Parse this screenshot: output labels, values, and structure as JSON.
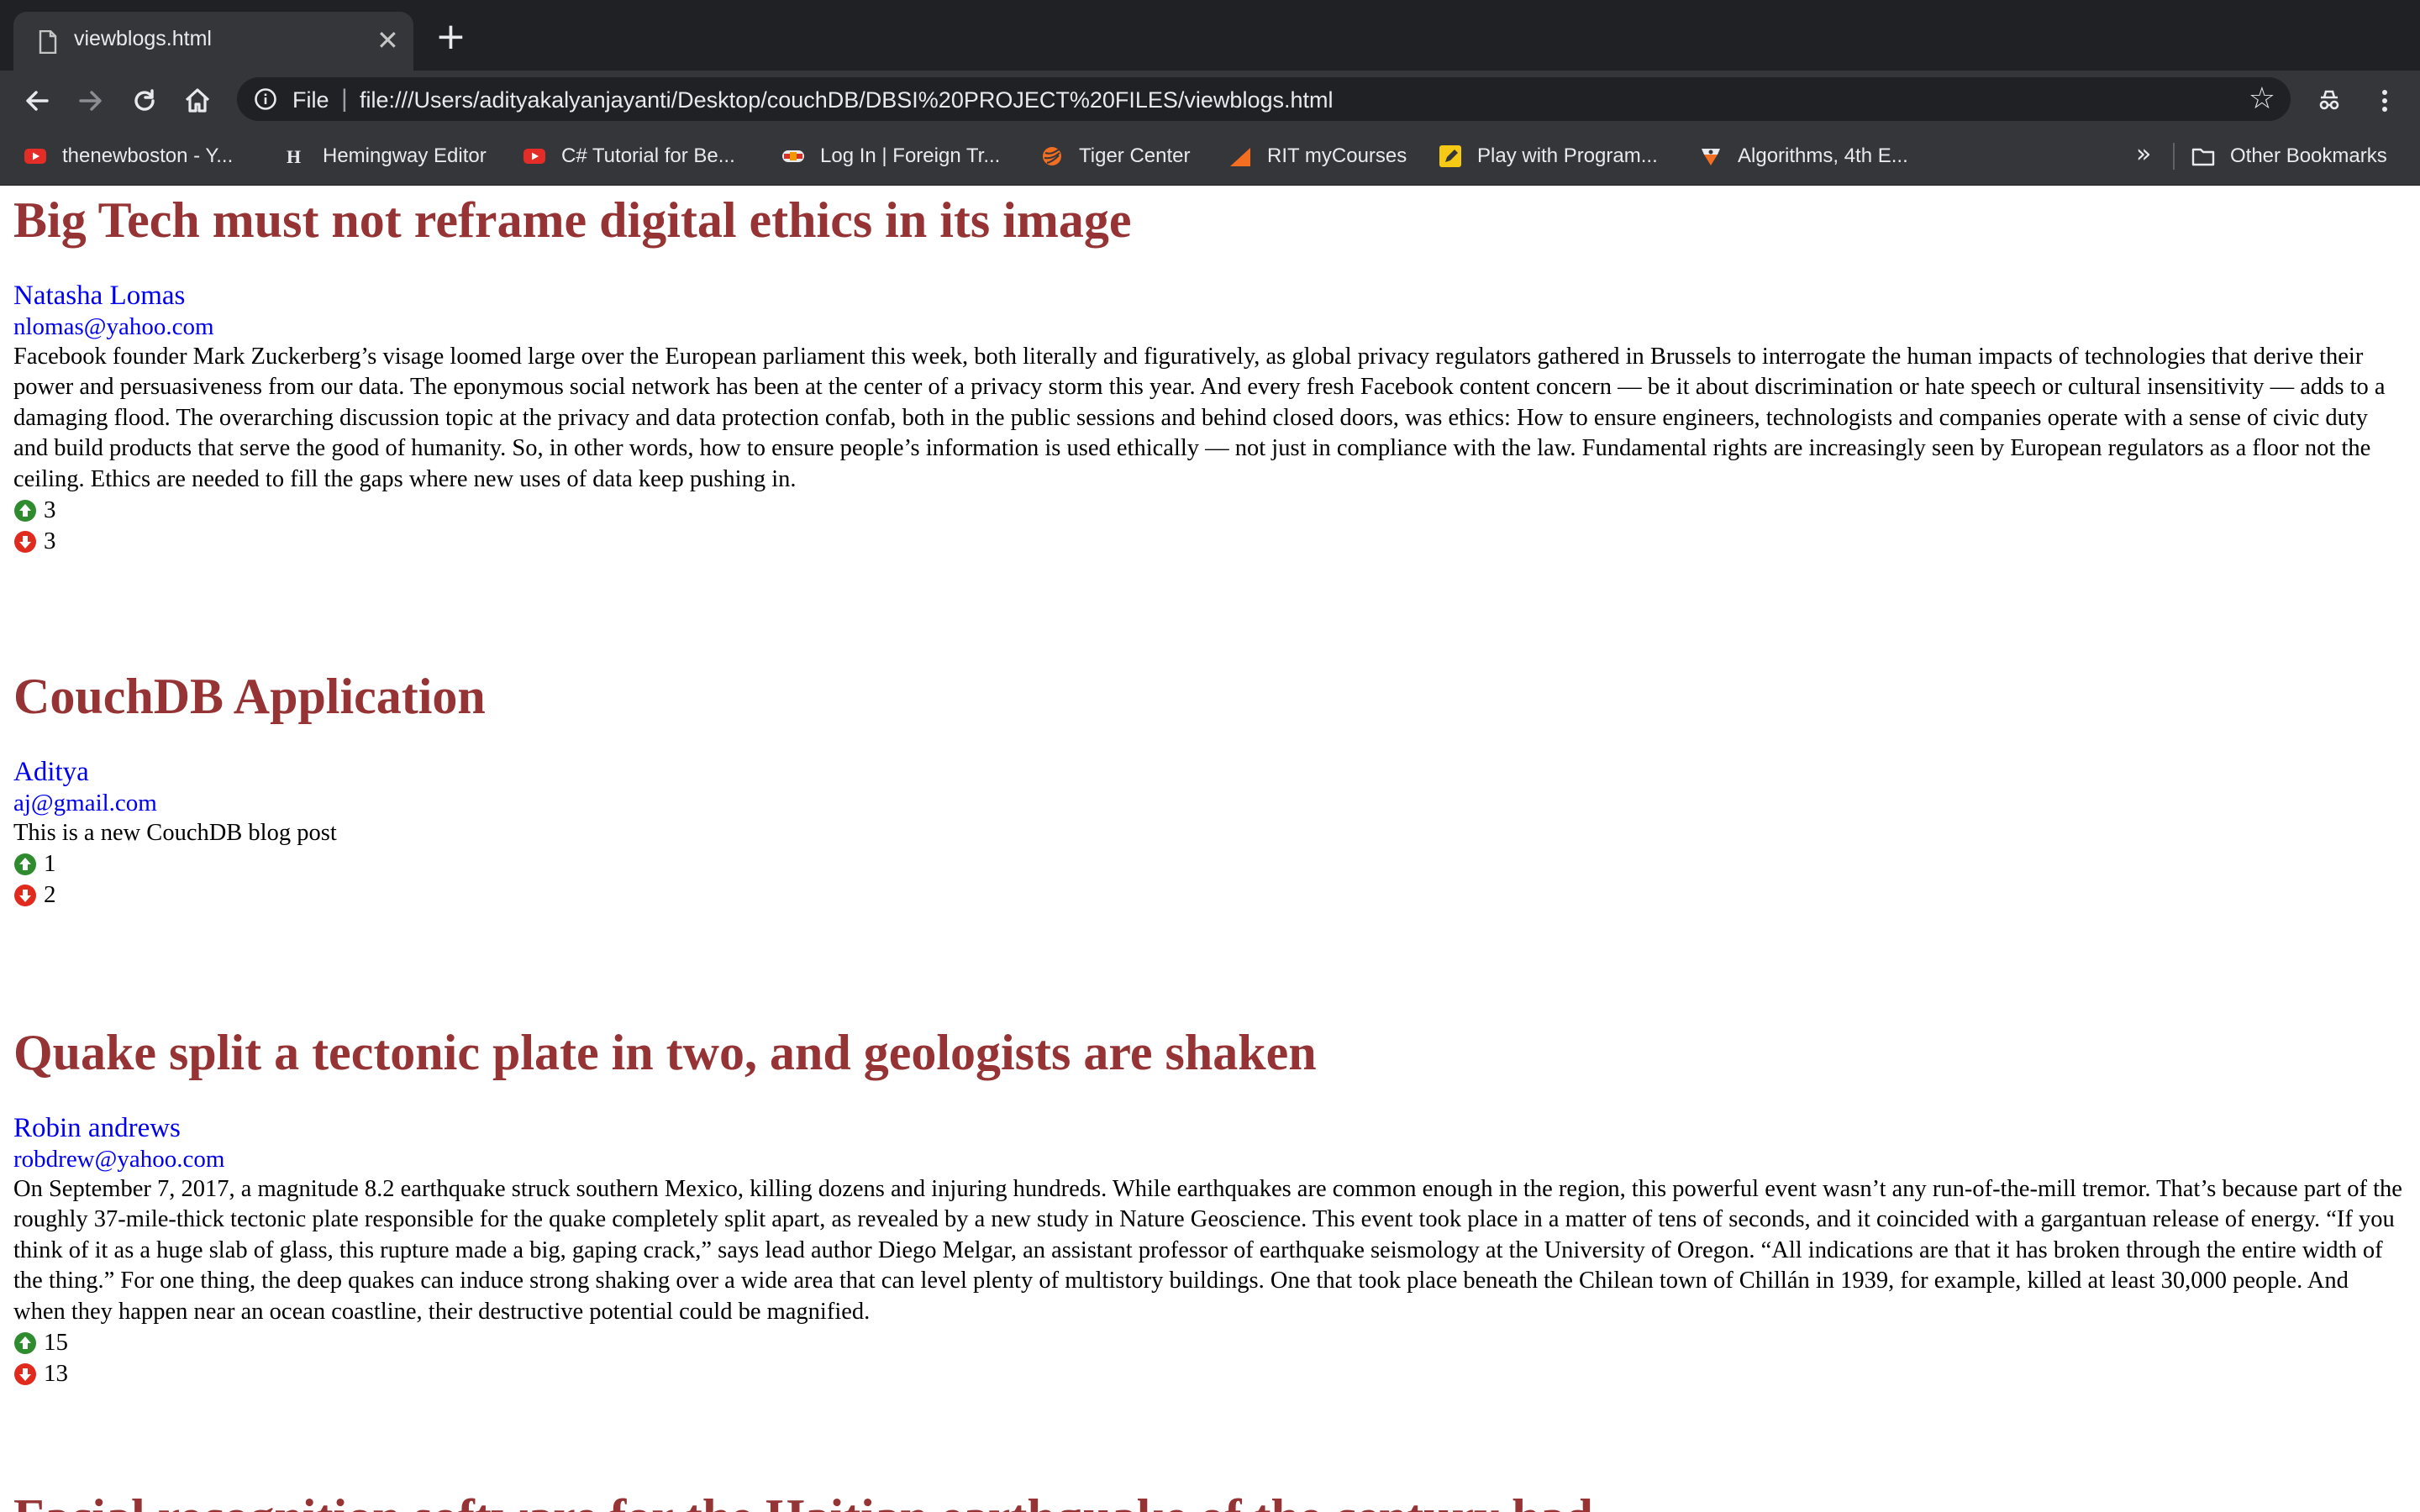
{
  "browser": {
    "tab_title": "viewblogs.html",
    "omnibox_scheme": "File",
    "url": "file:///Users/adityakalyanjayanti/Desktop/couchDB/DBSI%20PROJECT%20FILES/viewblogs.html",
    "bookmarks": [
      {
        "label": "thenewboston - Y...",
        "icon": "youtube-icon"
      },
      {
        "label": "Hemingway Editor",
        "icon": "hemingway-icon"
      },
      {
        "label": "C# Tutorial for Be...",
        "icon": "youtube-icon"
      },
      {
        "label": "Log In | Foreign Tr...",
        "icon": "login-icon"
      },
      {
        "label": "Tiger Center",
        "icon": "tiger-icon"
      },
      {
        "label": "RIT myCourses",
        "icon": "mycourses-icon"
      },
      {
        "label": "Play with Program...",
        "icon": "pencil-icon"
      },
      {
        "label": "Algorithms, 4th E...",
        "icon": "algorithms-icon"
      }
    ],
    "more_label": "»",
    "other_bookmarks": "Other Bookmarks"
  },
  "posts": [
    {
      "title": "Big Tech must not reframe digital ethics in its image",
      "author": "Natasha Lomas",
      "email": "nlomas@yahoo.com",
      "body": "Facebook founder Mark Zuckerberg’s visage loomed large over the European parliament this week, both literally and figuratively, as global privacy regulators gathered in Brussels to interrogate the human impacts of technologies that derive their power and persuasiveness from our data. The eponymous social network has been at the center of a privacy storm this year. And every fresh Facebook content concern — be it about discrimination or hate speech or cultural insensitivity — adds to a damaging flood. The overarching discussion topic at the privacy and data protection confab, both in the public sessions and behind closed doors, was ethics: How to ensure engineers, technologists and companies operate with a sense of civic duty and build products that serve the good of humanity. So, in other words, how to ensure people’s information is used ethically — not just in compliance with the law. Fundamental rights are increasingly seen by European regulators as a floor not the ceiling. Ethics are needed to fill the gaps where new uses of data keep pushing in.",
      "upvotes": "3",
      "downvotes": "3"
    },
    {
      "title": "CouchDB Application",
      "author": "Aditya",
      "email": "aj@gmail.com",
      "body": "This is a new CouchDB blog post",
      "upvotes": "1",
      "downvotes": "2"
    },
    {
      "title": "Quake split a tectonic plate in two, and geologists are shaken",
      "author": "Robin andrews",
      "email": "robdrew@yahoo.com",
      "body": "On September 7, 2017, a magnitude 8.2 earthquake struck southern Mexico, killing dozens and injuring hundreds. While earthquakes are common enough in the region, this powerful event wasn’t any run-of-the-mill tremor. That’s because part of the roughly 37-mile-thick tectonic plate responsible for the quake completely split apart, as revealed by a new study in Nature Geoscience. This event took place in a matter of tens of seconds, and it coincided with a gargantuan release of energy. “If you think of it as a huge slab of glass, this rupture made a big, gaping crack,” says lead author Diego Melgar, an assistant professor of earthquake seismology at the University of Oregon. “All indications are that it has broken through the entire width of the thing.” For one thing, the deep quakes can induce strong shaking over a wide area that can level plenty of multistory buildings. One that took place beneath the Chilean town of Chillán in 1939, for example, killed at least 30,000 people. And when they happen near an ocean coastline, their destructive potential could be magnified.",
      "upvotes": "15",
      "downvotes": "13"
    },
    {
      "title": "Facial recognition software for the Haitian earthquake of the century had",
      "author": "",
      "email": "",
      "body": "",
      "upvotes": "",
      "downvotes": ""
    }
  ]
}
